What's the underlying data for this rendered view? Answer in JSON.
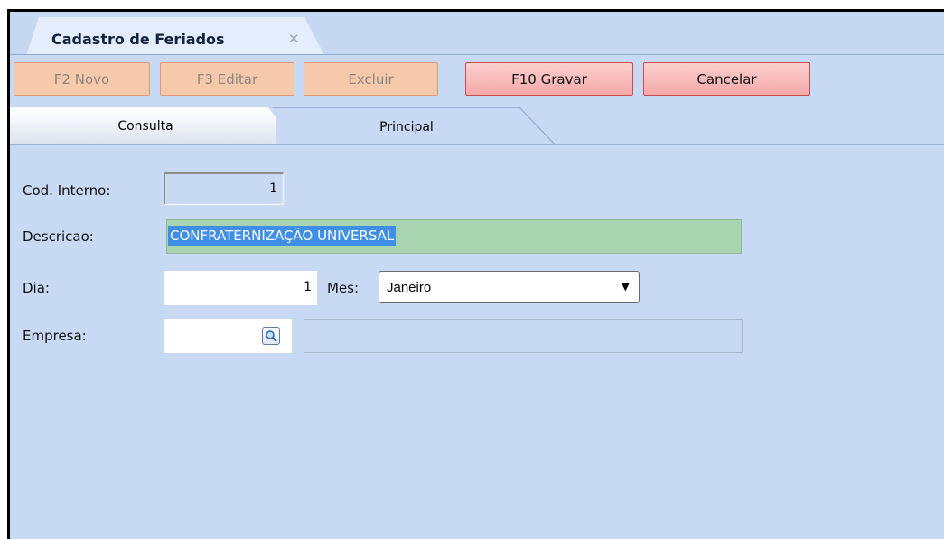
{
  "document_tab": {
    "title": "Cadastro de Feriados",
    "close_glyph": "✕"
  },
  "toolbar": {
    "novo": "F2 Novo",
    "editar": "F3 Editar",
    "excluir": "Excluir",
    "gravar": "F10 Gravar",
    "cancelar": "Cancelar"
  },
  "tabs": {
    "consulta": "Consulta",
    "principal": "Principal"
  },
  "form": {
    "cod_label": "Cod. Interno:",
    "cod_value": "1",
    "desc_label": "Descricao:",
    "desc_value": "CONFRATERNIZAÇÃO UNIVERSAL",
    "dia_label": "Dia:",
    "dia_value": "1",
    "mes_label": "Mes:",
    "mes_value": "Janeiro",
    "empresa_label": "Empresa:",
    "empresa_value": "",
    "empresa_desc": ""
  },
  "colors": {
    "background": "#c8daf3",
    "button_disabled": "#f6c9ab",
    "button_active": "#f5a8a8",
    "selection": "#3f8fe7",
    "focused_field": "#a8d4b0"
  },
  "icons": {
    "dropdown": "chevron-down-icon",
    "lookup": "magnifier-icon"
  }
}
